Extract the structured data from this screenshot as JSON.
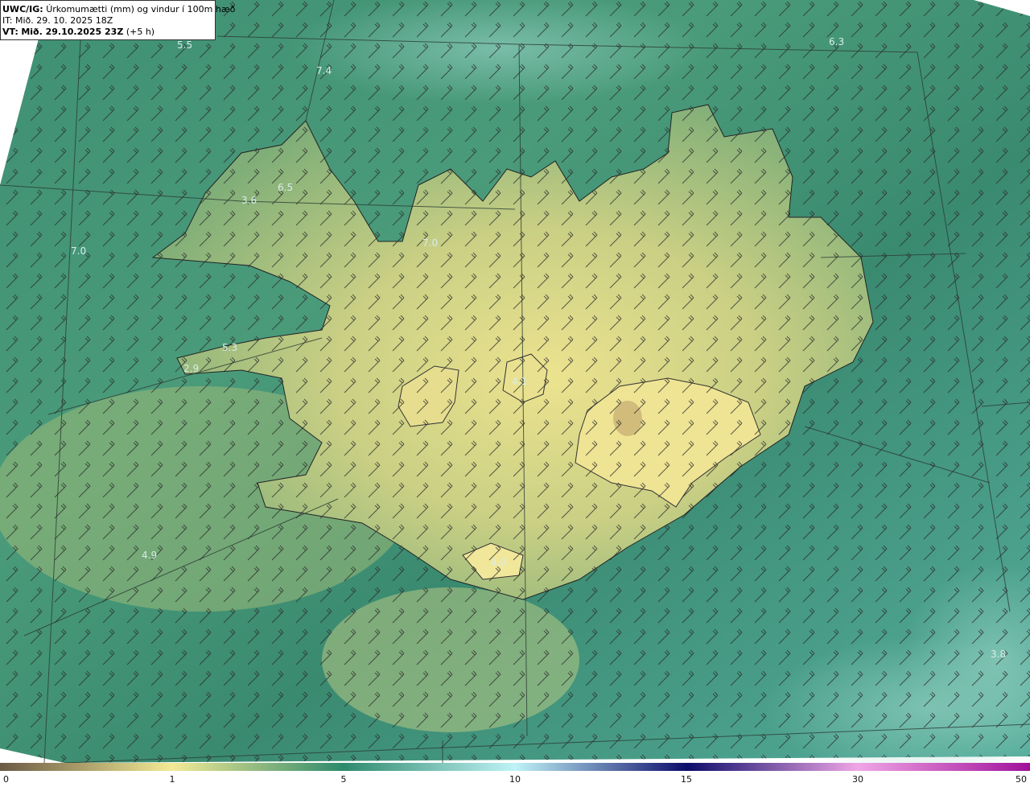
{
  "header": {
    "model": "UWC/IG:",
    "title": "Úrkomumætti (mm) og vindur í 100m hæð",
    "it_label": "IT:",
    "it_value": "Mið. 29. 10. 2025 18Z",
    "vt_label": "VT:",
    "vt_value": "Mið. 29.10.2025 23Z",
    "vt_offset": "(+5 h)"
  },
  "colorbar": {
    "ticks": [
      "0",
      "1",
      "5",
      "10",
      "15",
      "30",
      "50"
    ],
    "colors": [
      "#6b5a44",
      "#f3ea95",
      "#2e8a6c",
      "#bff3f7",
      "#0d0d6b",
      "#f0a6e6",
      "#a0109a"
    ]
  },
  "map_labels": [
    "5.5",
    "7.4",
    "6.3",
    "3.6",
    "6.5",
    "7.0",
    "7.0",
    "5.3",
    "2.9",
    "4.1",
    "4.9",
    "4.0",
    "3.8"
  ],
  "colors": {
    "sea_dark": "#2f7e67",
    "sea_light": "#5fb3a4",
    "land_low": "#a8c27a",
    "land_high": "#ece38f"
  }
}
